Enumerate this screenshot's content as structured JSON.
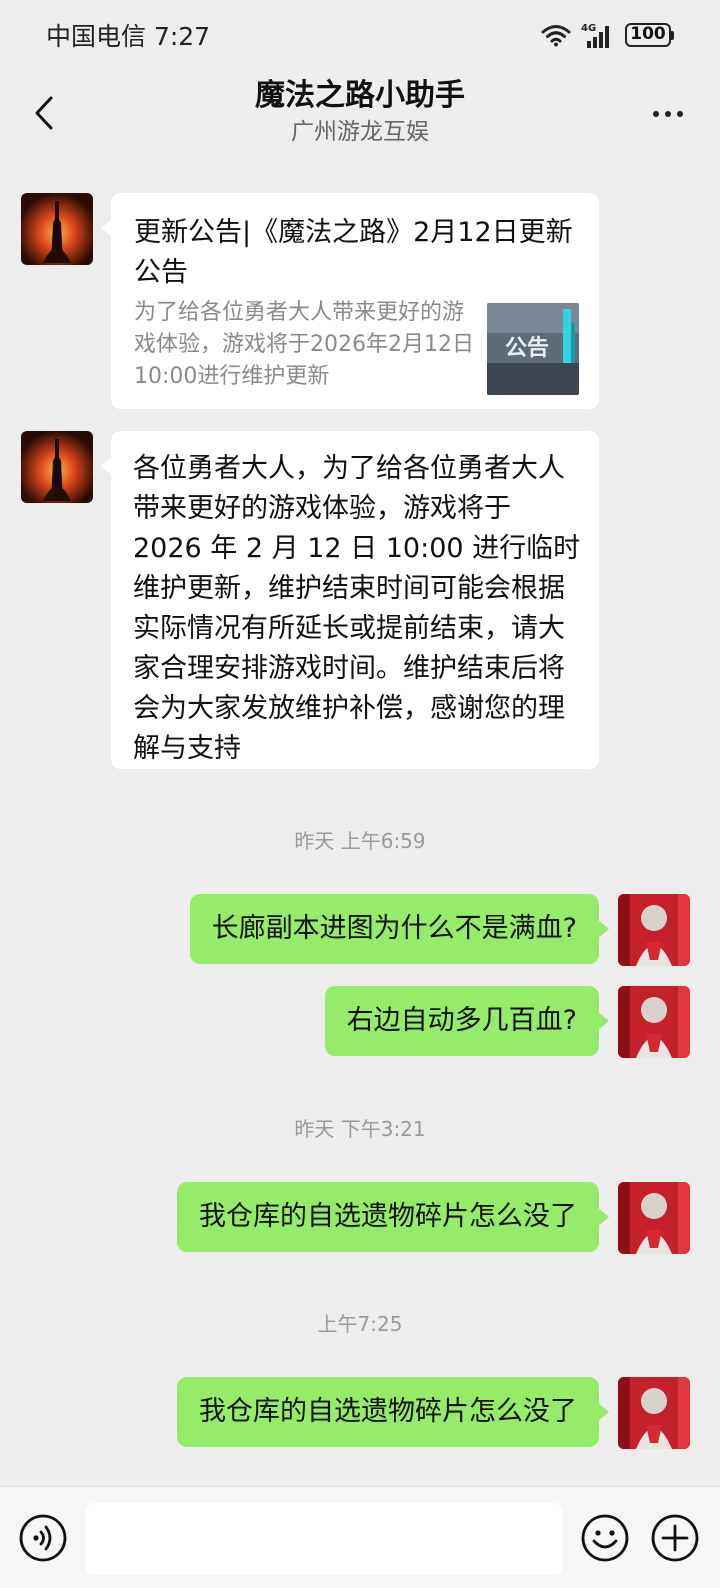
{
  "status": {
    "carrier_time": "中国电信 7:27",
    "network": "4G",
    "battery": "100"
  },
  "header": {
    "title": "魔法之路小助手",
    "subtitle": "广州游龙互娱"
  },
  "messages": {
    "article": {
      "title": "更新公告|《魔法之路》2月12日更新公告",
      "description": "为了给各位勇者大人带来更好的游戏体验，游戏将于2026年2月12日10:00进行维护更新",
      "thumb_text": "公告"
    },
    "notice": "各位勇者大人，为了给各位勇者大人带来更好的游戏体验，游戏将于 2026 年 2 月 12 日 10:00 进行临时维护更新，维护结束时间可能会根据实际情况有所延长或提前结束，请大家合理安排游戏时间。维护结束后将会为大家发放维护补偿，感谢您的理解与支持",
    "time1": "昨天 上午6:59",
    "user1": "长廊副本进图为什么不是满血?",
    "user2": "右边自动多几百血?",
    "time2": "昨天 下午3:21",
    "user3": "我仓库的自选遗物碎片怎么没了",
    "time3": "上午7:25",
    "user4": "我仓库的自选遗物碎片怎么没了"
  },
  "input": {
    "placeholder": ""
  },
  "colors": {
    "background": "#ededed",
    "bubble_user": "#95ec69",
    "bubble_bot": "#ffffff"
  },
  "icons": [
    "wifi-icon",
    "signal-icon",
    "battery-icon",
    "back-icon",
    "more-icon",
    "voice-icon",
    "emoji-icon",
    "add-icon"
  ]
}
